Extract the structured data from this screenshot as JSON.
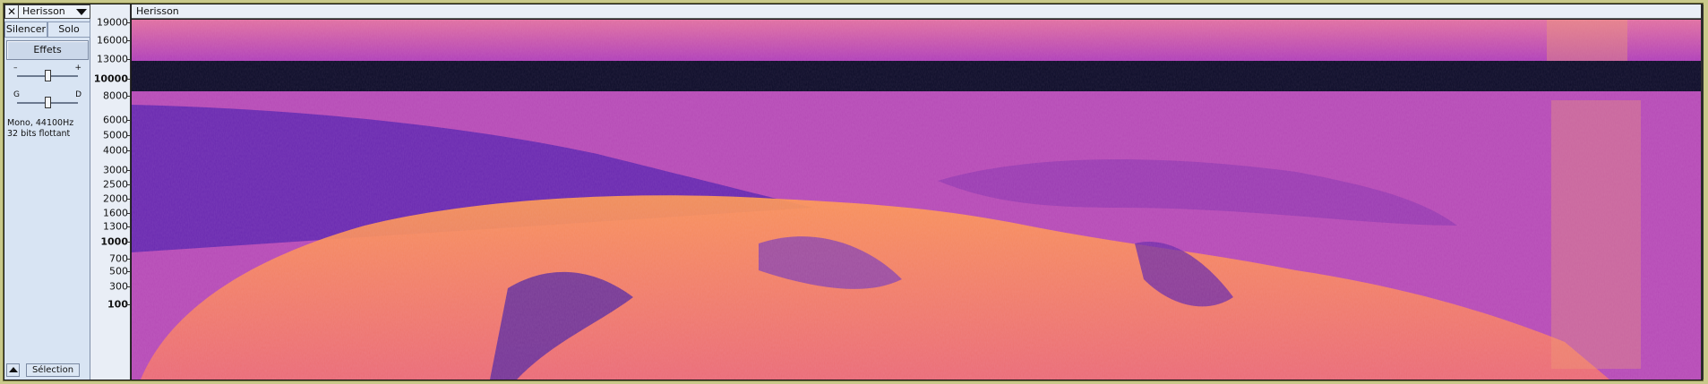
{
  "track": {
    "close_glyph": "✕",
    "name": "Herisson",
    "mute_label": "Silencer",
    "solo_label": "Solo",
    "effects_label": "Effets",
    "gain": {
      "minus": "–",
      "plus": "+"
    },
    "pan": {
      "left": "G",
      "right": "D"
    },
    "info_line1": "Mono, 44100Hz",
    "info_line2": "32 bits flottant",
    "select_label": "Sélection"
  },
  "clip": {
    "title": "Herisson"
  },
  "ruler": {
    "ticks": [
      {
        "label": "19000",
        "major": false
      },
      {
        "label": "16000",
        "major": false
      },
      {
        "label": "13000",
        "major": false
      },
      {
        "label": "10000",
        "major": true
      },
      {
        "label": "8000",
        "major": false
      },
      {
        "label": "6000",
        "major": false
      },
      {
        "label": "5000",
        "major": false
      },
      {
        "label": "4000",
        "major": false
      },
      {
        "label": "3000",
        "major": false
      },
      {
        "label": "2500",
        "major": false
      },
      {
        "label": "2000",
        "major": false
      },
      {
        "label": "1600",
        "major": false
      },
      {
        "label": "1300",
        "major": false
      },
      {
        "label": "1000",
        "major": true
      },
      {
        "label": "700",
        "major": false
      },
      {
        "label": "500",
        "major": false
      },
      {
        "label": "300",
        "major": false
      },
      {
        "label": "100",
        "major": true
      }
    ]
  },
  "colors": {
    "panel_bg": "#d8e4f3",
    "spectrogram_hot": "#ff9a3c",
    "spectrogram_mid": "#c040c0",
    "spectrogram_cold": "#4a2aa0",
    "band_dark": "#0c0c28"
  },
  "icons": {
    "close": "close-icon",
    "dropdown": "chevron-down-icon",
    "collapse": "collapse-up-icon"
  }
}
